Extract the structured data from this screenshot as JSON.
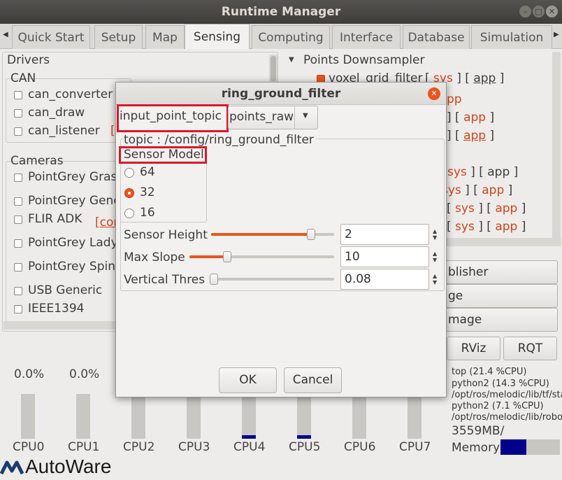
{
  "window": {
    "title": "Runtime Manager"
  },
  "tabs": [
    "Quick Start",
    "Setup",
    "Map",
    "Sensing",
    "Computing",
    "Interface",
    "Database",
    "Simulation"
  ],
  "left": {
    "drivers_label": "Drivers",
    "can_label": "CAN",
    "can_items": [
      "can_converter",
      "can_draw",
      "can_listener"
    ],
    "cameras_label": "Cameras",
    "camera_items": [
      "PointGrey Grass",
      "PointGrey Gene",
      "FLIR ADK",
      "PointGrey Lady",
      "PointGrey Spinn",
      "USB Generic",
      "IEEE1394"
    ],
    "can_listener_fragment": "[",
    "flir_fragment": "[cor"
  },
  "right": {
    "points_label": "Points Downsampler",
    "voxel": "voxel_grid_filter",
    "sys": "sys",
    "app": "app",
    "frag_pp": "pp",
    "button_fragments": [
      "blisher",
      "ge",
      "mage"
    ],
    "rviz": "RViz",
    "rqt": "RQT"
  },
  "cpus": [
    {
      "label": "CPU0",
      "pct": "0.0%",
      "level": 0
    },
    {
      "label": "CPU1",
      "pct": "0.0%",
      "level": 0
    },
    {
      "label": "CPU2",
      "pct": "",
      "level": 0
    },
    {
      "label": "CPU3",
      "pct": "",
      "level": 0
    },
    {
      "label": "CPU4",
      "pct": "",
      "level": 0.08
    },
    {
      "label": "CPU5",
      "pct": "",
      "level": 0.08
    },
    {
      "label": "CPU6",
      "pct": "",
      "level": 0
    },
    {
      "label": "CPU7",
      "pct": "",
      "level": 0
    }
  ],
  "processes": [
    "top (21.4 %CPU)",
    "python2 (14.3 %CPU)",
    "/opt/ros/melodic/lib/tf/sta",
    "python2 (7.1 %CPU)",
    "/opt/ros/melodic/lib/robot"
  ],
  "memory": {
    "value": "3559MB/",
    "label": "Memory",
    "level": 0.43
  },
  "logo": "AutoWare",
  "dialog": {
    "title": "ring_ground_filter",
    "topic_label": "input_point_topic",
    "topic_value": "points_raw",
    "topic_path": "topic : /config/ring_ground_filter",
    "sensor_model_label": "Sensor Model",
    "sensor_options": [
      "64",
      "32",
      "16"
    ],
    "sensor_selected": "32",
    "params": [
      {
        "label": "Sensor Height",
        "value": "2",
        "level": 0.81
      },
      {
        "label": "Max Slope",
        "value": "10",
        "level": 0.26
      },
      {
        "label": "Vertical Thres",
        "value": "0.08",
        "level": 0.02
      }
    ],
    "ok": "OK",
    "cancel": "Cancel"
  }
}
